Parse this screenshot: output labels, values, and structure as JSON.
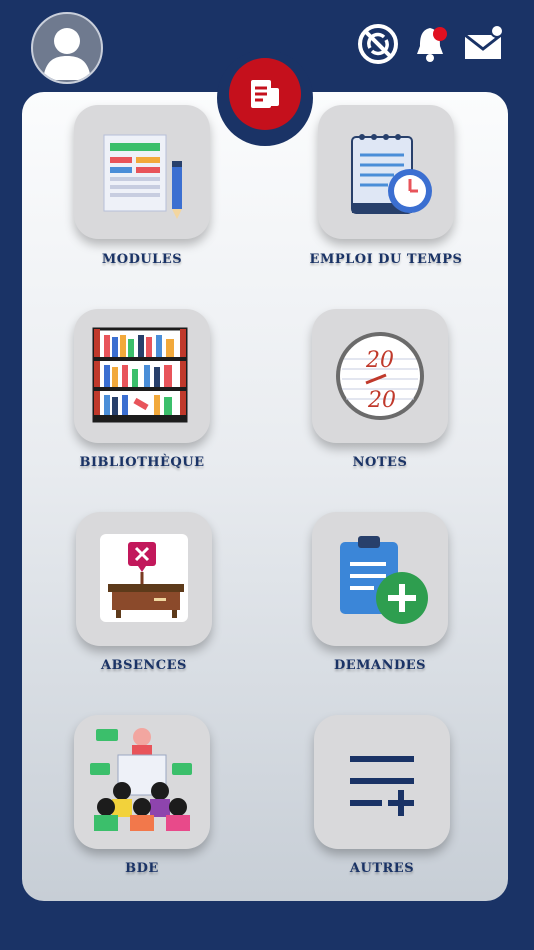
{
  "header": {
    "avatar_icon": "user-avatar-icon",
    "icons": [
      "sync-off-icon",
      "notification-bell-icon",
      "mail-icon"
    ],
    "notification_dot_color": "#e01020"
  },
  "badge": {
    "icon": "document-icon",
    "color": "#c5101c"
  },
  "menu": {
    "items": [
      {
        "label": "MODULES",
        "icon": "modules-icon"
      },
      {
        "label": "EMPLOI DU TEMPS",
        "icon": "calendar-clock-icon"
      },
      {
        "label": "BIBLIOTHÈQUE",
        "icon": "bookshelf-icon"
      },
      {
        "label": "NOTES",
        "icon": "grade-icon",
        "grade_top": "20",
        "grade_bottom": "20"
      },
      {
        "label": "ABSENCES",
        "icon": "absent-desk-icon"
      },
      {
        "label": "DEMANDES",
        "icon": "clipboard-add-icon"
      },
      {
        "label": "BDE",
        "icon": "student-group-icon"
      },
      {
        "label": "AUTRES",
        "icon": "add-list-icon"
      }
    ]
  },
  "colors": {
    "navy": "#1a3366",
    "accent_red": "#c5101c"
  }
}
